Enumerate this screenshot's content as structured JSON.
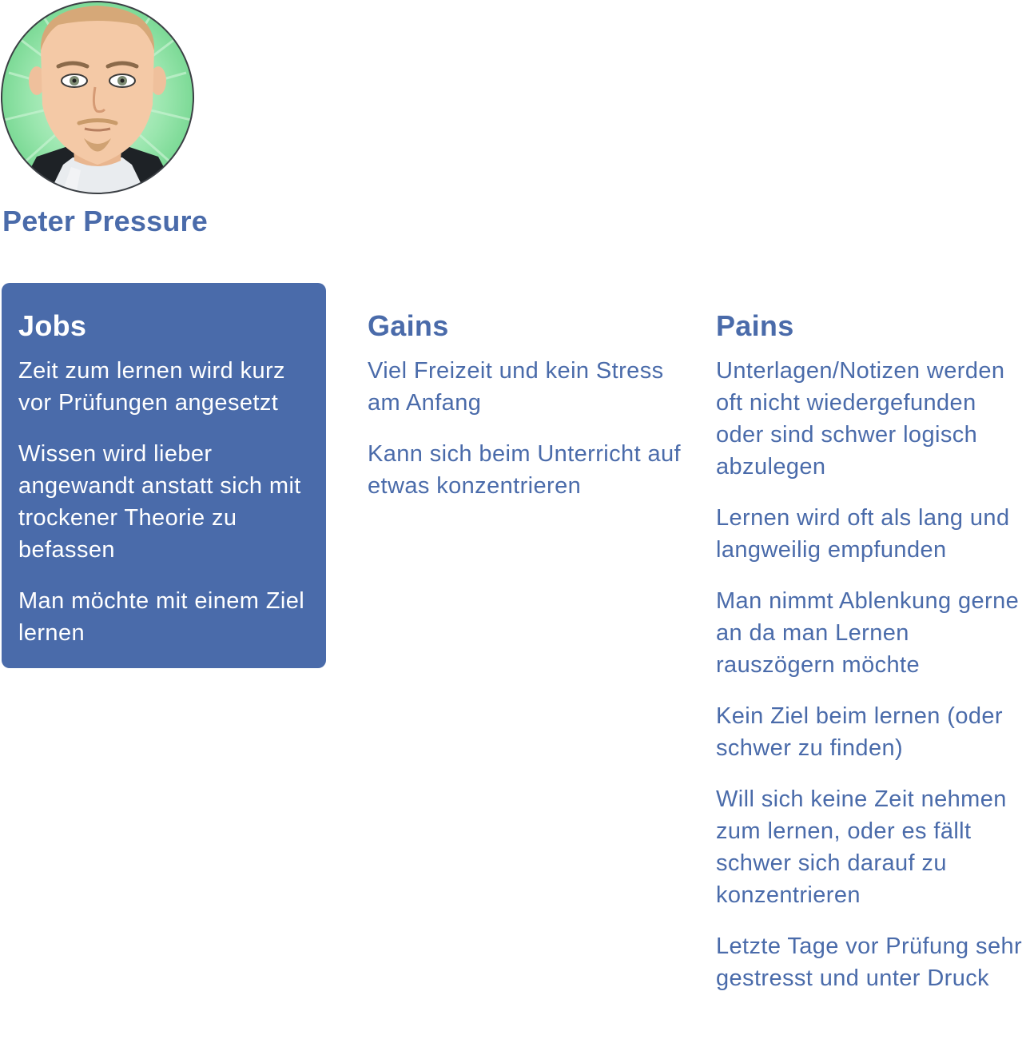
{
  "persona": {
    "name": "Peter Pressure",
    "avatar_icon": "cartoon-man-avatar",
    "colors": {
      "accent": "#4a6baa",
      "avatar_background": "#8fe0a4"
    }
  },
  "jobs": {
    "title": "Jobs",
    "items": [
      "Zeit zum lernen wird kurz vor Prüfungen angesetzt",
      "Wissen wird lieber angewandt anstatt sich mit trockener Theorie zu befassen",
      "Man möchte mit einem Ziel lernen"
    ]
  },
  "gains": {
    "title": "Gains",
    "items": [
      "Viel Freizeit und kein Stress am Anfang",
      "Kann sich beim Unterricht auf etwas konzentrieren"
    ]
  },
  "pains": {
    "title": "Pains",
    "items": [
      "Unterlagen/Notizen werden oft nicht wiedergefunden oder sind schwer logisch abzulegen",
      "Lernen wird oft als lang und langweilig empfunden",
      "Man nimmt Ablenkung gerne an da man Lernen rauszögern möchte",
      "Kein Ziel beim lernen (oder schwer zu finden)",
      "Will sich keine Zeit nehmen zum lernen, oder es fällt schwer sich darauf zu konzentrieren",
      "Letzte Tage vor Prüfung sehr gestresst und unter Druck"
    ]
  }
}
